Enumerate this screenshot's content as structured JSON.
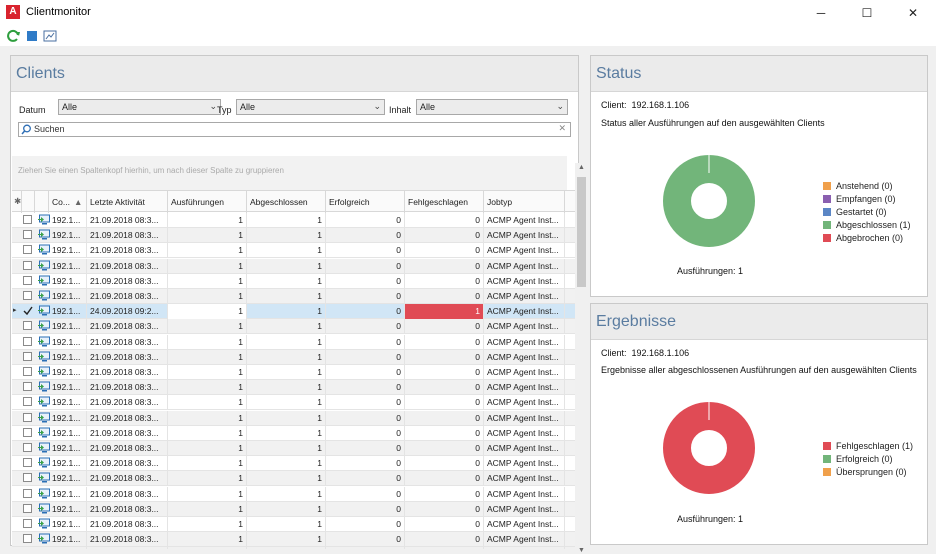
{
  "window": {
    "title": "Clientmonitor",
    "app_icon_letter": "A",
    "minimize": "─",
    "maximize": "☐",
    "close": "✕"
  },
  "toolbar": {
    "icons": [
      "refresh-icon",
      "stop-icon",
      "report-icon"
    ]
  },
  "clients_panel": {
    "title": "Clients",
    "filters": {
      "datum_label": "Datum",
      "datum_value": "Alle",
      "typ_label": "Typ",
      "typ_value": "Alle",
      "inhalt_label": "Inhalt",
      "inhalt_value": "Alle"
    },
    "search_placeholder": "Suchen",
    "group_hint": "Ziehen Sie einen Spaltenkopf hierhin, um nach dieser Spalte zu gruppieren",
    "columns": [
      "Co...",
      "Letzte Aktivität",
      "Ausführungen",
      "Abgeschlossen",
      "Erfolgreich",
      "Fehlgeschlagen",
      "Jobtyp"
    ],
    "rows": [
      {
        "computer": "192.1...",
        "last": "21.09.2018 08:3...",
        "ausf": "1",
        "abg": "1",
        "erf": "0",
        "fehl": "0",
        "jobtyp": "ACMP Agent Inst...",
        "checked": false,
        "selected": false
      },
      {
        "computer": "192.1...",
        "last": "21.09.2018 08:3...",
        "ausf": "1",
        "abg": "1",
        "erf": "0",
        "fehl": "0",
        "jobtyp": "ACMP Agent Inst...",
        "checked": false,
        "selected": false
      },
      {
        "computer": "192.1...",
        "last": "21.09.2018 08:3...",
        "ausf": "1",
        "abg": "1",
        "erf": "0",
        "fehl": "0",
        "jobtyp": "ACMP Agent Inst...",
        "checked": false,
        "selected": false
      },
      {
        "computer": "192.1...",
        "last": "21.09.2018 08:3...",
        "ausf": "1",
        "abg": "1",
        "erf": "0",
        "fehl": "0",
        "jobtyp": "ACMP Agent Inst...",
        "checked": false,
        "selected": false
      },
      {
        "computer": "192.1...",
        "last": "21.09.2018 08:3...",
        "ausf": "1",
        "abg": "1",
        "erf": "0",
        "fehl": "0",
        "jobtyp": "ACMP Agent Inst...",
        "checked": false,
        "selected": false
      },
      {
        "computer": "192.1...",
        "last": "21.09.2018 08:3...",
        "ausf": "1",
        "abg": "1",
        "erf": "0",
        "fehl": "0",
        "jobtyp": "ACMP Agent Inst...",
        "checked": false,
        "selected": false
      },
      {
        "computer": "192.1...",
        "last": "24.09.2018 09:2...",
        "ausf": "1",
        "abg": "1",
        "erf": "0",
        "fehl": "1",
        "jobtyp": "ACMP Agent Inst...",
        "checked": true,
        "selected": true
      },
      {
        "computer": "192.1...",
        "last": "21.09.2018 08:3...",
        "ausf": "1",
        "abg": "1",
        "erf": "0",
        "fehl": "0",
        "jobtyp": "ACMP Agent Inst...",
        "checked": false,
        "selected": false
      },
      {
        "computer": "192.1...",
        "last": "21.09.2018 08:3...",
        "ausf": "1",
        "abg": "1",
        "erf": "0",
        "fehl": "0",
        "jobtyp": "ACMP Agent Inst...",
        "checked": false,
        "selected": false
      },
      {
        "computer": "192.1...",
        "last": "21.09.2018 08:3...",
        "ausf": "1",
        "abg": "1",
        "erf": "0",
        "fehl": "0",
        "jobtyp": "ACMP Agent Inst...",
        "checked": false,
        "selected": false
      },
      {
        "computer": "192.1...",
        "last": "21.09.2018 08:3...",
        "ausf": "1",
        "abg": "1",
        "erf": "0",
        "fehl": "0",
        "jobtyp": "ACMP Agent Inst...",
        "checked": false,
        "selected": false
      },
      {
        "computer": "192.1...",
        "last": "21.09.2018 08:3...",
        "ausf": "1",
        "abg": "1",
        "erf": "0",
        "fehl": "0",
        "jobtyp": "ACMP Agent Inst...",
        "checked": false,
        "selected": false
      },
      {
        "computer": "192.1...",
        "last": "21.09.2018 08:3...",
        "ausf": "1",
        "abg": "1",
        "erf": "0",
        "fehl": "0",
        "jobtyp": "ACMP Agent Inst...",
        "checked": false,
        "selected": false
      },
      {
        "computer": "192.1...",
        "last": "21.09.2018 08:3...",
        "ausf": "1",
        "abg": "1",
        "erf": "0",
        "fehl": "0",
        "jobtyp": "ACMP Agent Inst...",
        "checked": false,
        "selected": false
      },
      {
        "computer": "192.1...",
        "last": "21.09.2018 08:3...",
        "ausf": "1",
        "abg": "1",
        "erf": "0",
        "fehl": "0",
        "jobtyp": "ACMP Agent Inst...",
        "checked": false,
        "selected": false
      },
      {
        "computer": "192.1...",
        "last": "21.09.2018 08:3...",
        "ausf": "1",
        "abg": "1",
        "erf": "0",
        "fehl": "0",
        "jobtyp": "ACMP Agent Inst...",
        "checked": false,
        "selected": false
      },
      {
        "computer": "192.1...",
        "last": "21.09.2018 08:3...",
        "ausf": "1",
        "abg": "1",
        "erf": "0",
        "fehl": "0",
        "jobtyp": "ACMP Agent Inst...",
        "checked": false,
        "selected": false
      },
      {
        "computer": "192.1...",
        "last": "21.09.2018 08:3...",
        "ausf": "1",
        "abg": "1",
        "erf": "0",
        "fehl": "0",
        "jobtyp": "ACMP Agent Inst...",
        "checked": false,
        "selected": false
      },
      {
        "computer": "192.1...",
        "last": "21.09.2018 08:3...",
        "ausf": "1",
        "abg": "1",
        "erf": "0",
        "fehl": "0",
        "jobtyp": "ACMP Agent Inst...",
        "checked": false,
        "selected": false
      },
      {
        "computer": "192.1...",
        "last": "21.09.2018 08:3...",
        "ausf": "1",
        "abg": "1",
        "erf": "0",
        "fehl": "0",
        "jobtyp": "ACMP Agent Inst...",
        "checked": false,
        "selected": false
      },
      {
        "computer": "192.1...",
        "last": "21.09.2018 08:3...",
        "ausf": "1",
        "abg": "1",
        "erf": "0",
        "fehl": "0",
        "jobtyp": "ACMP Agent Inst...",
        "checked": false,
        "selected": false
      },
      {
        "computer": "192.1...",
        "last": "21.09.2018 08:3...",
        "ausf": "1",
        "abg": "1",
        "erf": "0",
        "fehl": "0",
        "jobtyp": "ACMP Agent Inst...",
        "checked": false,
        "selected": false
      },
      {
        "computer": "",
        "last": "",
        "ausf": "",
        "abg": "",
        "erf": "",
        "fehl": "",
        "jobtyp": "",
        "checked": false,
        "selected": false
      }
    ]
  },
  "status_panel": {
    "title": "Status",
    "client_label": "Client:",
    "client_value": "192.168.1.106",
    "description": "Status aller Ausführungen auf den ausgewählten Clients",
    "legend": [
      {
        "label": "Anstehend (0)",
        "color": "#f0a04b"
      },
      {
        "label": "Empfangen (0)",
        "color": "#8a5fb0"
      },
      {
        "label": "Gestartet (0)",
        "color": "#5b86c5"
      },
      {
        "label": "Abgeschlossen (1)",
        "color": "#72b57a"
      },
      {
        "label": "Abgebrochen (0)",
        "color": "#e04b55"
      }
    ],
    "ring_color": "#72b57a",
    "footer": "Ausführungen: 1"
  },
  "results_panel": {
    "title": "Ergebnisse",
    "client_label": "Client:",
    "client_value": "192.168.1.106",
    "description": "Ergebnisse aller abgeschlossenen Ausführungen auf den ausgewählten Clients",
    "legend": [
      {
        "label": "Fehlgeschlagen (1)",
        "color": "#e04b55"
      },
      {
        "label": "Erfolgreich (0)",
        "color": "#72b57a"
      },
      {
        "label": "Übersprungen (0)",
        "color": "#f0a04b"
      }
    ],
    "ring_color": "#e04b55",
    "footer": "Ausführungen: 1"
  },
  "colors": {
    "title_accent": "#5a7ca0",
    "selection": "#d1e6f6",
    "fail_cell": "#e04b55"
  }
}
